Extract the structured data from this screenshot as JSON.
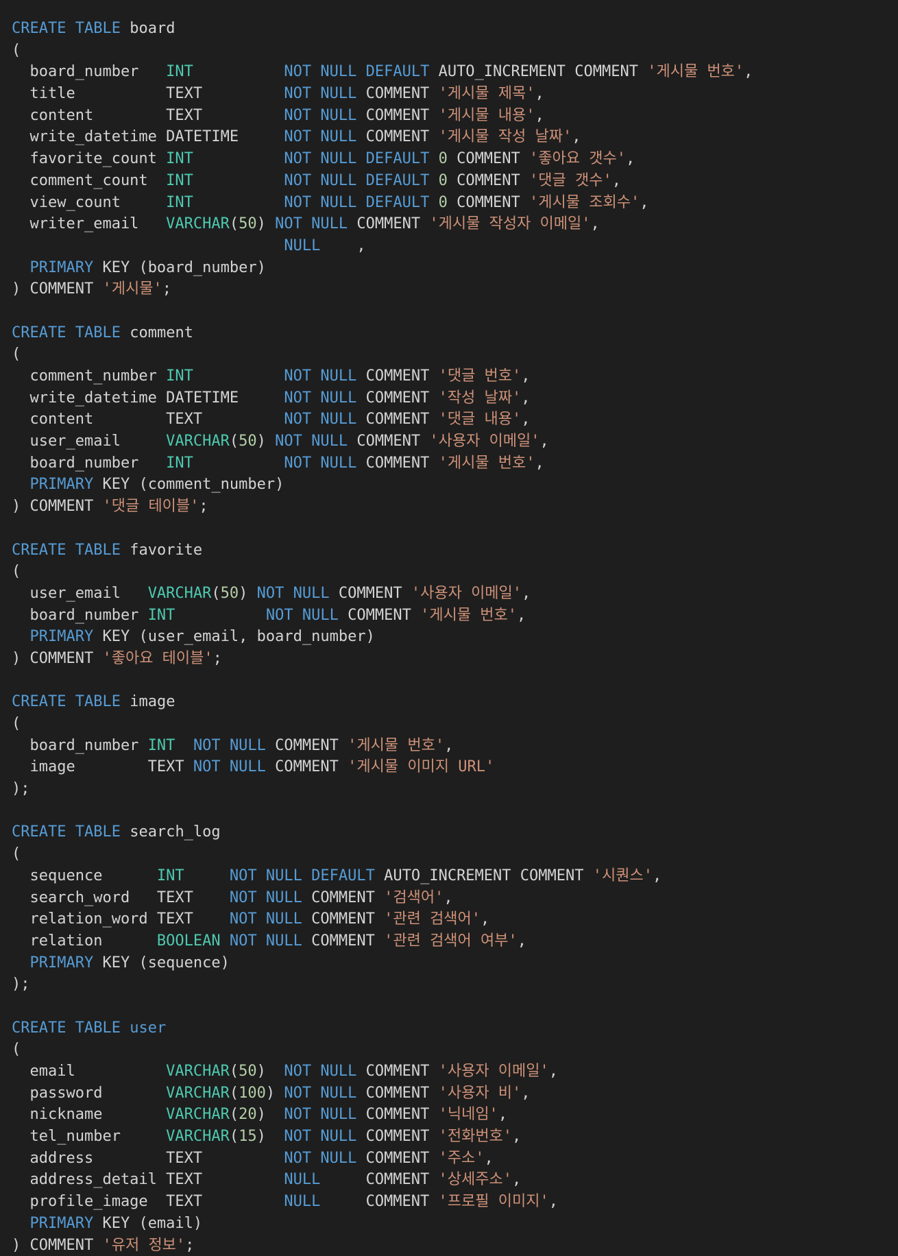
{
  "theme": {
    "background": "#1e1e1e",
    "token_colors": {
      "kw": "#569cd6",
      "type": "#4ec9b0",
      "num": "#b5cea8",
      "str": "#ce9178",
      "id": "#d4d4d4",
      "punct": "#d4d4d4"
    }
  },
  "code": {
    "lines": [
      [
        [
          "kw",
          "CREATE"
        ],
        [
          "id",
          " "
        ],
        [
          "kw",
          "TABLE"
        ],
        [
          "id",
          " board"
        ]
      ],
      [
        [
          "punct",
          "("
        ]
      ],
      [
        [
          "id",
          "  board_number   "
        ],
        [
          "type",
          "INT"
        ],
        [
          "id",
          "          "
        ],
        [
          "kw",
          "NOT"
        ],
        [
          "id",
          " "
        ],
        [
          "kw",
          "NULL"
        ],
        [
          "id",
          " "
        ],
        [
          "kw",
          "DEFAULT"
        ],
        [
          "id",
          " AUTO_INCREMENT COMMENT "
        ],
        [
          "str",
          "'게시물 번호'"
        ],
        [
          "punct",
          ","
        ]
      ],
      [
        [
          "id",
          "  title          TEXT         "
        ],
        [
          "kw",
          "NOT"
        ],
        [
          "id",
          " "
        ],
        [
          "kw",
          "NULL"
        ],
        [
          "id",
          " COMMENT "
        ],
        [
          "str",
          "'게시물 제목'"
        ],
        [
          "punct",
          ","
        ]
      ],
      [
        [
          "id",
          "  content        TEXT         "
        ],
        [
          "kw",
          "NOT"
        ],
        [
          "id",
          " "
        ],
        [
          "kw",
          "NULL"
        ],
        [
          "id",
          " COMMENT "
        ],
        [
          "str",
          "'게시물 내용'"
        ],
        [
          "punct",
          ","
        ]
      ],
      [
        [
          "id",
          "  write_datetime DATETIME     "
        ],
        [
          "kw",
          "NOT"
        ],
        [
          "id",
          " "
        ],
        [
          "kw",
          "NULL"
        ],
        [
          "id",
          " COMMENT "
        ],
        [
          "str",
          "'게시물 작성 날짜'"
        ],
        [
          "punct",
          ","
        ]
      ],
      [
        [
          "id",
          "  favorite_count "
        ],
        [
          "type",
          "INT"
        ],
        [
          "id",
          "          "
        ],
        [
          "kw",
          "NOT"
        ],
        [
          "id",
          " "
        ],
        [
          "kw",
          "NULL"
        ],
        [
          "id",
          " "
        ],
        [
          "kw",
          "DEFAULT"
        ],
        [
          "id",
          " "
        ],
        [
          "num",
          "0"
        ],
        [
          "id",
          " COMMENT "
        ],
        [
          "str",
          "'좋아요 갯수'"
        ],
        [
          "punct",
          ","
        ]
      ],
      [
        [
          "id",
          "  comment_count  "
        ],
        [
          "type",
          "INT"
        ],
        [
          "id",
          "          "
        ],
        [
          "kw",
          "NOT"
        ],
        [
          "id",
          " "
        ],
        [
          "kw",
          "NULL"
        ],
        [
          "id",
          " "
        ],
        [
          "kw",
          "DEFAULT"
        ],
        [
          "id",
          " "
        ],
        [
          "num",
          "0"
        ],
        [
          "id",
          " COMMENT "
        ],
        [
          "str",
          "'댓글 갯수'"
        ],
        [
          "punct",
          ","
        ]
      ],
      [
        [
          "id",
          "  view_count     "
        ],
        [
          "type",
          "INT"
        ],
        [
          "id",
          "          "
        ],
        [
          "kw",
          "NOT"
        ],
        [
          "id",
          " "
        ],
        [
          "kw",
          "NULL"
        ],
        [
          "id",
          " "
        ],
        [
          "kw",
          "DEFAULT"
        ],
        [
          "id",
          " "
        ],
        [
          "num",
          "0"
        ],
        [
          "id",
          " COMMENT "
        ],
        [
          "str",
          "'게시물 조회수'"
        ],
        [
          "punct",
          ","
        ]
      ],
      [
        [
          "id",
          "  writer_email   "
        ],
        [
          "type",
          "VARCHAR"
        ],
        [
          "punct",
          "("
        ],
        [
          "num",
          "50"
        ],
        [
          "punct",
          ")"
        ],
        [
          "id",
          " "
        ],
        [
          "kw",
          "NOT"
        ],
        [
          "id",
          " "
        ],
        [
          "kw",
          "NULL"
        ],
        [
          "id",
          " COMMENT "
        ],
        [
          "str",
          "'게시물 작성자 이메일'"
        ],
        [
          "punct",
          ","
        ]
      ],
      [
        [
          "id",
          "                              "
        ],
        [
          "kw",
          "NULL"
        ],
        [
          "id",
          "    "
        ],
        [
          "punct",
          ","
        ]
      ],
      [
        [
          "id",
          "  "
        ],
        [
          "kw",
          "PRIMARY"
        ],
        [
          "id",
          " KEY (board_number)"
        ]
      ],
      [
        [
          "punct",
          ")"
        ],
        [
          "id",
          " COMMENT "
        ],
        [
          "str",
          "'게시물'"
        ],
        [
          "punct",
          ";"
        ]
      ],
      [],
      [
        [
          "kw",
          "CREATE"
        ],
        [
          "id",
          " "
        ],
        [
          "kw",
          "TABLE"
        ],
        [
          "id",
          " comment"
        ]
      ],
      [
        [
          "punct",
          "("
        ]
      ],
      [
        [
          "id",
          "  comment_number "
        ],
        [
          "type",
          "INT"
        ],
        [
          "id",
          "          "
        ],
        [
          "kw",
          "NOT"
        ],
        [
          "id",
          " "
        ],
        [
          "kw",
          "NULL"
        ],
        [
          "id",
          " COMMENT "
        ],
        [
          "str",
          "'댓글 번호'"
        ],
        [
          "punct",
          ","
        ]
      ],
      [
        [
          "id",
          "  write_datetime DATETIME     "
        ],
        [
          "kw",
          "NOT"
        ],
        [
          "id",
          " "
        ],
        [
          "kw",
          "NULL"
        ],
        [
          "id",
          " COMMENT "
        ],
        [
          "str",
          "'작성 날짜'"
        ],
        [
          "punct",
          ","
        ]
      ],
      [
        [
          "id",
          "  content        TEXT         "
        ],
        [
          "kw",
          "NOT"
        ],
        [
          "id",
          " "
        ],
        [
          "kw",
          "NULL"
        ],
        [
          "id",
          " COMMENT "
        ],
        [
          "str",
          "'댓글 내용'"
        ],
        [
          "punct",
          ","
        ]
      ],
      [
        [
          "id",
          "  user_email     "
        ],
        [
          "type",
          "VARCHAR"
        ],
        [
          "punct",
          "("
        ],
        [
          "num",
          "50"
        ],
        [
          "punct",
          ")"
        ],
        [
          "id",
          " "
        ],
        [
          "kw",
          "NOT"
        ],
        [
          "id",
          " "
        ],
        [
          "kw",
          "NULL"
        ],
        [
          "id",
          " COMMENT "
        ],
        [
          "str",
          "'사용자 이메일'"
        ],
        [
          "punct",
          ","
        ]
      ],
      [
        [
          "id",
          "  board_number   "
        ],
        [
          "type",
          "INT"
        ],
        [
          "id",
          "          "
        ],
        [
          "kw",
          "NOT"
        ],
        [
          "id",
          " "
        ],
        [
          "kw",
          "NULL"
        ],
        [
          "id",
          " COMMENT "
        ],
        [
          "str",
          "'게시물 번호'"
        ],
        [
          "punct",
          ","
        ]
      ],
      [
        [
          "id",
          "  "
        ],
        [
          "kw",
          "PRIMARY"
        ],
        [
          "id",
          " KEY (comment_number)"
        ]
      ],
      [
        [
          "punct",
          ")"
        ],
        [
          "id",
          " COMMENT "
        ],
        [
          "str",
          "'댓글 테이블'"
        ],
        [
          "punct",
          ";"
        ]
      ],
      [],
      [
        [
          "kw",
          "CREATE"
        ],
        [
          "id",
          " "
        ],
        [
          "kw",
          "TABLE"
        ],
        [
          "id",
          " favorite"
        ]
      ],
      [
        [
          "punct",
          "("
        ]
      ],
      [
        [
          "id",
          "  user_email   "
        ],
        [
          "type",
          "VARCHAR"
        ],
        [
          "punct",
          "("
        ],
        [
          "num",
          "50"
        ],
        [
          "punct",
          ")"
        ],
        [
          "id",
          " "
        ],
        [
          "kw",
          "NOT"
        ],
        [
          "id",
          " "
        ],
        [
          "kw",
          "NULL"
        ],
        [
          "id",
          " COMMENT "
        ],
        [
          "str",
          "'사용자 이메일'"
        ],
        [
          "punct",
          ","
        ]
      ],
      [
        [
          "id",
          "  board_number "
        ],
        [
          "type",
          "INT"
        ],
        [
          "id",
          "          "
        ],
        [
          "kw",
          "NOT"
        ],
        [
          "id",
          " "
        ],
        [
          "kw",
          "NULL"
        ],
        [
          "id",
          " COMMENT "
        ],
        [
          "str",
          "'게시물 번호'"
        ],
        [
          "punct",
          ","
        ]
      ],
      [
        [
          "id",
          "  "
        ],
        [
          "kw",
          "PRIMARY"
        ],
        [
          "id",
          " KEY (user_email, board_number)"
        ]
      ],
      [
        [
          "punct",
          ")"
        ],
        [
          "id",
          " COMMENT "
        ],
        [
          "str",
          "'좋아요 테이블'"
        ],
        [
          "punct",
          ";"
        ]
      ],
      [],
      [
        [
          "kw",
          "CREATE"
        ],
        [
          "id",
          " "
        ],
        [
          "kw",
          "TABLE"
        ],
        [
          "id",
          " image"
        ]
      ],
      [
        [
          "punct",
          "("
        ]
      ],
      [
        [
          "id",
          "  board_number "
        ],
        [
          "type",
          "INT"
        ],
        [
          "id",
          "  "
        ],
        [
          "kw",
          "NOT"
        ],
        [
          "id",
          " "
        ],
        [
          "kw",
          "NULL"
        ],
        [
          "id",
          " COMMENT "
        ],
        [
          "str",
          "'게시물 번호'"
        ],
        [
          "punct",
          ","
        ]
      ],
      [
        [
          "id",
          "  image        TEXT "
        ],
        [
          "kw",
          "NOT"
        ],
        [
          "id",
          " "
        ],
        [
          "kw",
          "NULL"
        ],
        [
          "id",
          " COMMENT "
        ],
        [
          "str",
          "'게시물 이미지 URL'"
        ]
      ],
      [
        [
          "punct",
          ");"
        ]
      ],
      [],
      [
        [
          "kw",
          "CREATE"
        ],
        [
          "id",
          " "
        ],
        [
          "kw",
          "TABLE"
        ],
        [
          "id",
          " search_log"
        ]
      ],
      [
        [
          "punct",
          "("
        ]
      ],
      [
        [
          "id",
          "  sequence      "
        ],
        [
          "type",
          "INT"
        ],
        [
          "id",
          "     "
        ],
        [
          "kw",
          "NOT"
        ],
        [
          "id",
          " "
        ],
        [
          "kw",
          "NULL"
        ],
        [
          "id",
          " "
        ],
        [
          "kw",
          "DEFAULT"
        ],
        [
          "id",
          " AUTO_INCREMENT COMMENT "
        ],
        [
          "str",
          "'시퀀스'"
        ],
        [
          "punct",
          ","
        ]
      ],
      [
        [
          "id",
          "  search_word   TEXT    "
        ],
        [
          "kw",
          "NOT"
        ],
        [
          "id",
          " "
        ],
        [
          "kw",
          "NULL"
        ],
        [
          "id",
          " COMMENT "
        ],
        [
          "str",
          "'검색어'"
        ],
        [
          "punct",
          ","
        ]
      ],
      [
        [
          "id",
          "  relation_word TEXT    "
        ],
        [
          "kw",
          "NOT"
        ],
        [
          "id",
          " "
        ],
        [
          "kw",
          "NULL"
        ],
        [
          "id",
          " COMMENT "
        ],
        [
          "str",
          "'관련 검색어'"
        ],
        [
          "punct",
          ","
        ]
      ],
      [
        [
          "id",
          "  relation      "
        ],
        [
          "type",
          "BOOLEAN"
        ],
        [
          "id",
          " "
        ],
        [
          "kw",
          "NOT"
        ],
        [
          "id",
          " "
        ],
        [
          "kw",
          "NULL"
        ],
        [
          "id",
          " COMMENT "
        ],
        [
          "str",
          "'관련 검색어 여부'"
        ],
        [
          "punct",
          ","
        ]
      ],
      [
        [
          "id",
          "  "
        ],
        [
          "kw",
          "PRIMARY"
        ],
        [
          "id",
          " KEY (sequence)"
        ]
      ],
      [
        [
          "punct",
          ");"
        ]
      ],
      [],
      [
        [
          "kw",
          "CREATE"
        ],
        [
          "id",
          " "
        ],
        [
          "kw",
          "TABLE"
        ],
        [
          "id",
          " "
        ],
        [
          "kw",
          "user"
        ]
      ],
      [
        [
          "punct",
          "("
        ]
      ],
      [
        [
          "id",
          "  email          "
        ],
        [
          "type",
          "VARCHAR"
        ],
        [
          "punct",
          "("
        ],
        [
          "num",
          "50"
        ],
        [
          "punct",
          ")"
        ],
        [
          "id",
          "  "
        ],
        [
          "kw",
          "NOT"
        ],
        [
          "id",
          " "
        ],
        [
          "kw",
          "NULL"
        ],
        [
          "id",
          " COMMENT "
        ],
        [
          "str",
          "'사용자 이메일'"
        ],
        [
          "punct",
          ","
        ]
      ],
      [
        [
          "id",
          "  password       "
        ],
        [
          "type",
          "VARCHAR"
        ],
        [
          "punct",
          "("
        ],
        [
          "num",
          "100"
        ],
        [
          "punct",
          ")"
        ],
        [
          "id",
          " "
        ],
        [
          "kw",
          "NOT"
        ],
        [
          "id",
          " "
        ],
        [
          "kw",
          "NULL"
        ],
        [
          "id",
          " COMMENT "
        ],
        [
          "str",
          "'사용자 비'"
        ],
        [
          "punct",
          ","
        ]
      ],
      [
        [
          "id",
          "  nickname       "
        ],
        [
          "type",
          "VARCHAR"
        ],
        [
          "punct",
          "("
        ],
        [
          "num",
          "20"
        ],
        [
          "punct",
          ")"
        ],
        [
          "id",
          "  "
        ],
        [
          "kw",
          "NOT"
        ],
        [
          "id",
          " "
        ],
        [
          "kw",
          "NULL"
        ],
        [
          "id",
          " COMMENT "
        ],
        [
          "str",
          "'닉네임'"
        ],
        [
          "punct",
          ","
        ]
      ],
      [
        [
          "id",
          "  tel_number     "
        ],
        [
          "type",
          "VARCHAR"
        ],
        [
          "punct",
          "("
        ],
        [
          "num",
          "15"
        ],
        [
          "punct",
          ")"
        ],
        [
          "id",
          "  "
        ],
        [
          "kw",
          "NOT"
        ],
        [
          "id",
          " "
        ],
        [
          "kw",
          "NULL"
        ],
        [
          "id",
          " COMMENT "
        ],
        [
          "str",
          "'전화번호'"
        ],
        [
          "punct",
          ","
        ]
      ],
      [
        [
          "id",
          "  address        TEXT         "
        ],
        [
          "kw",
          "NOT"
        ],
        [
          "id",
          " "
        ],
        [
          "kw",
          "NULL"
        ],
        [
          "id",
          " COMMENT "
        ],
        [
          "str",
          "'주소'"
        ],
        [
          "punct",
          ","
        ]
      ],
      [
        [
          "id",
          "  address_detail TEXT         "
        ],
        [
          "kw",
          "NULL"
        ],
        [
          "id",
          "     COMMENT "
        ],
        [
          "str",
          "'상세주소'"
        ],
        [
          "punct",
          ","
        ]
      ],
      [
        [
          "id",
          "  profile_image  TEXT         "
        ],
        [
          "kw",
          "NULL"
        ],
        [
          "id",
          "     COMMENT "
        ],
        [
          "str",
          "'프로필 이미지'"
        ],
        [
          "punct",
          ","
        ]
      ],
      [
        [
          "id",
          "  "
        ],
        [
          "kw",
          "PRIMARY"
        ],
        [
          "id",
          " KEY (email)"
        ]
      ],
      [
        [
          "punct",
          ")"
        ],
        [
          "id",
          " COMMENT "
        ],
        [
          "str",
          "'유저 정보'"
        ],
        [
          "punct",
          ";"
        ]
      ]
    ]
  }
}
